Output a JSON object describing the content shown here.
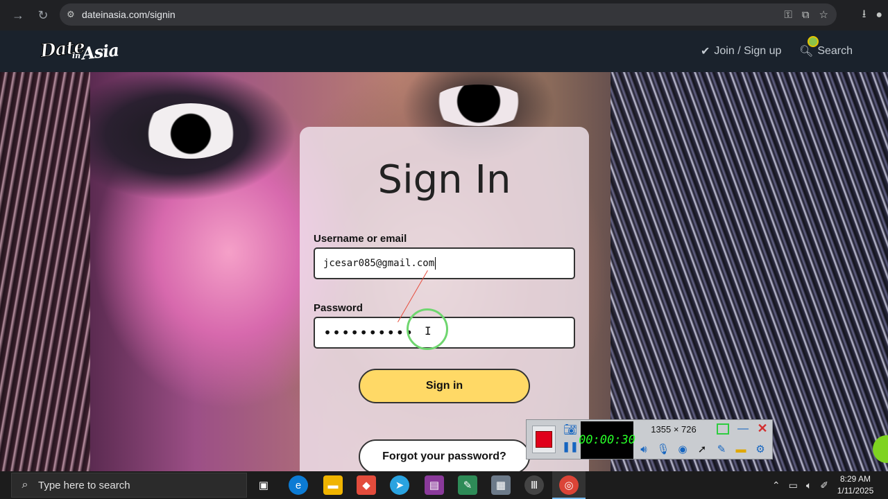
{
  "browser": {
    "url": "dateinasia.com/signin",
    "icons": [
      "back-arrow",
      "reload",
      "site-settings",
      "password-key",
      "install-app",
      "bookmark-star",
      "download",
      "profile"
    ]
  },
  "site": {
    "logo": {
      "line1": "Date",
      "line2": "in",
      "line3": "Asia"
    },
    "nav": {
      "join_label": "Join / Sign up",
      "search_label": "Search"
    }
  },
  "signin": {
    "title": "Sign In",
    "username_label": "Username or email",
    "username_value": "jcesar085@gmail.com",
    "password_label": "Password",
    "password_value": "••••••••••",
    "signin_button": "Sign in",
    "forgot_button": "Forgot your password?"
  },
  "recorder": {
    "timer": "00:00:30",
    "size": "1355 × 726",
    "colors": {
      "stop": "#e0001b",
      "timer_text": "#28ff28"
    }
  },
  "taskbar": {
    "search_placeholder": "Type here to search",
    "time": "8:29 AM",
    "date": "1/11/2025"
  },
  "colors": {
    "header_bg": "#1a222c",
    "signin_button_bg": "#ffd966",
    "cursor_ring": "#6fd66f"
  }
}
